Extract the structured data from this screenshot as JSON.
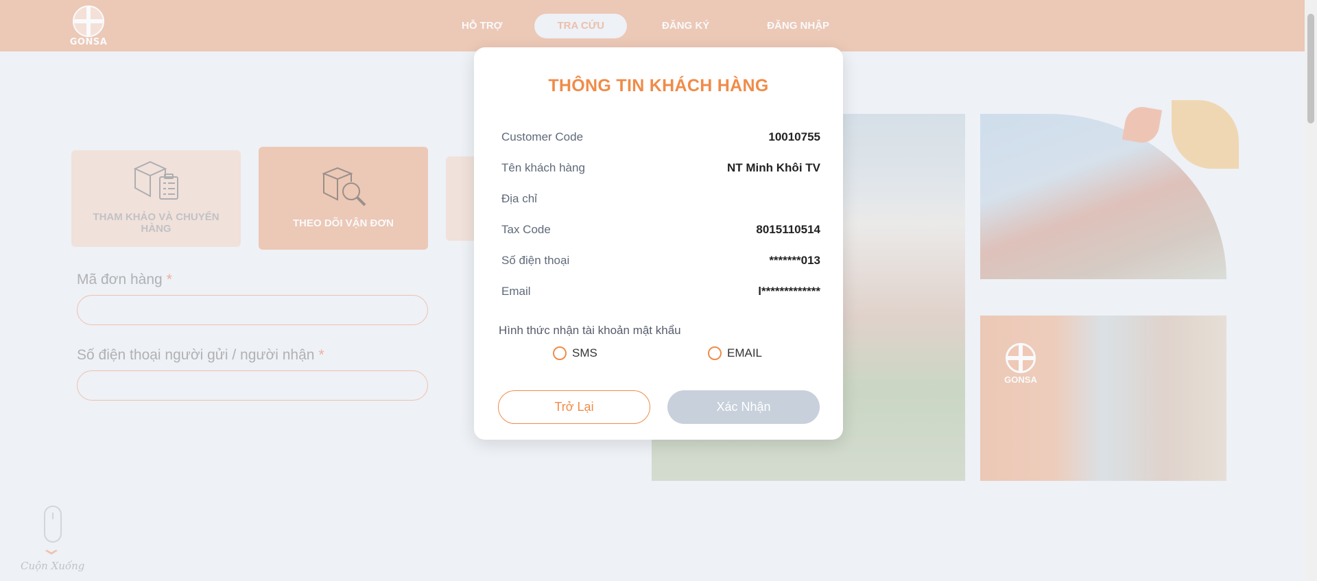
{
  "header": {
    "logo_text": "GONSA",
    "nav": [
      {
        "label": "HỖ TRỢ"
      },
      {
        "label": "TRA CỨU"
      },
      {
        "label": "ĐĂNG KÝ"
      },
      {
        "label": "ĐĂNG NHẬP"
      }
    ],
    "active_nav": "TRA CỨU"
  },
  "services": [
    {
      "label": "THAM KHẢO VÀ CHUYỂN HÀNG",
      "icon": "box-clipboard-icon"
    },
    {
      "label": "THEO DÕI VẬN ĐƠN",
      "icon": "box-search-icon"
    }
  ],
  "form": {
    "order_code": {
      "label": "Mã đơn hàng",
      "required_mark": "*",
      "value": ""
    },
    "phone": {
      "label": "Số điện thoại người gửi / người nhận",
      "required_mark": "*",
      "value": ""
    }
  },
  "photo_logo_text": "GONSA",
  "scroll_hint": "Cuộn Xuống",
  "modal": {
    "title": "THÔNG TIN KHÁCH HÀNG",
    "rows": [
      {
        "label": "Customer Code",
        "value": "10010755"
      },
      {
        "label": "Tên khách hàng",
        "value": "NT Minh Khôi TV"
      },
      {
        "label": "Địa chỉ",
        "value": ""
      },
      {
        "label": "Tax Code",
        "value": "8015110514"
      },
      {
        "label": "Số điện thoại",
        "value": "*******013"
      },
      {
        "label": "Email",
        "value": "l*************"
      }
    ],
    "method_label": "Hình thức nhận tài khoản mật khẩu",
    "options": [
      {
        "label": "SMS",
        "selected": false
      },
      {
        "label": "EMAIL",
        "selected": false
      }
    ],
    "back_label": "Trở Lại",
    "confirm_label": "Xác Nhận"
  },
  "colors": {
    "header": "#ecb394",
    "accent": "#f08b48",
    "background": "#eef1f6",
    "confirm_disabled": "#c7d0db"
  }
}
